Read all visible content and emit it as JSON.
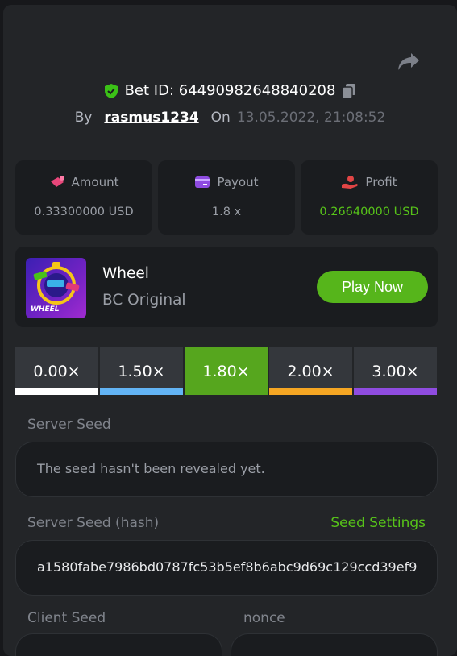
{
  "bet": {
    "id_label": "Bet ID: 64490982648840208",
    "by_label": "By",
    "user": "rasmus1234",
    "on_label": "On",
    "date": "13.05.2022, 21:08:52"
  },
  "stats": {
    "amount": {
      "label": "Amount",
      "value": "0.33300000 USD",
      "icon": "money-icon"
    },
    "payout": {
      "label": "Payout",
      "value": "1.8 x",
      "icon": "card-icon"
    },
    "profit": {
      "label": "Profit",
      "value": "0.26640000 USD",
      "icon": "hand-money-icon"
    }
  },
  "game": {
    "name": "Wheel",
    "provider": "BC Original",
    "thumb_text": "WHEEL",
    "play_label": "Play Now"
  },
  "multipliers": [
    {
      "label": "0.00×",
      "color": "#ffffff",
      "active": false
    },
    {
      "label": "1.50×",
      "color": "#63b4f5",
      "active": false
    },
    {
      "label": "1.80×",
      "color": "#56a61e",
      "active": true
    },
    {
      "label": "2.00×",
      "color": "#f5a623",
      "active": false
    },
    {
      "label": "3.00×",
      "color": "#8f4ce0",
      "active": false
    }
  ],
  "seeds": {
    "server_seed_label": "Server Seed",
    "server_seed_placeholder": "The seed hasn't been revealed yet.",
    "server_hash_label": "Server Seed (hash)",
    "seed_settings_label": "Seed Settings",
    "server_hash_value": "a1580fabe7986bd0787fc53b5ef8b6abc9d69c129ccd39ef9",
    "client_seed_label": "Client Seed",
    "nonce_label": "nonce"
  },
  "colors": {
    "accent_green": "#56b51b",
    "panel": "#232528",
    "card": "#1a1c1f"
  }
}
